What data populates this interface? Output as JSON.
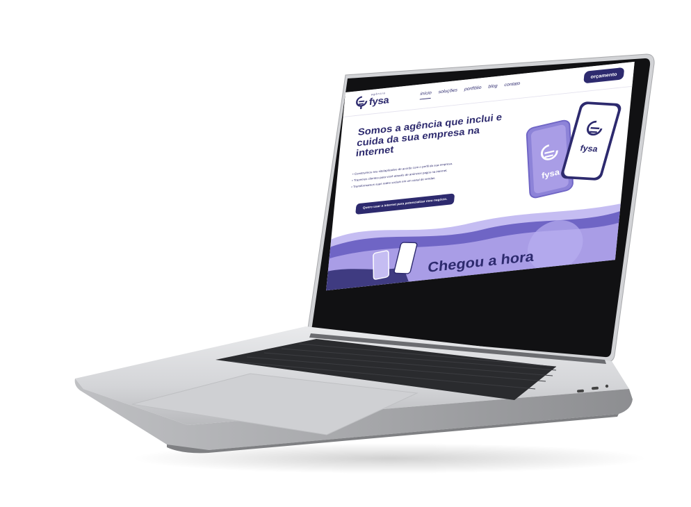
{
  "site": {
    "logo": {
      "brand": "fysa",
      "tagline": "agência",
      "icon": "fysa-logo-icon"
    },
    "nav": {
      "items": [
        {
          "label": "início",
          "active": true
        },
        {
          "label": "soluções"
        },
        {
          "label": "portfólio"
        },
        {
          "label": "blog"
        },
        {
          "label": "contato"
        }
      ],
      "cta_label": "orçamento"
    },
    "hero": {
      "title": "Somos a agência que inclui e cuida da sua empresa na internet",
      "bullets": [
        "Construímos seu site/aplicativo de acordo com o perfil da sua empresa.",
        "Trazemos clientes para você através de anúncios pagos na internet.",
        "Transformamos suas redes sociais em um canal de vendas."
      ],
      "button_label": "Quero usar a internet para potencializar meu negócio."
    },
    "section2": {
      "title_partial": "Chegou a hora"
    },
    "phone_brand": "fysa"
  },
  "colors": {
    "brand_dark": "#2d2a6e",
    "lavender": "#a99de6",
    "lavender_light": "#c5bdf2",
    "purple_mid": "#6f65c5",
    "laptop_silver": "#d9dadc",
    "bezel": "#121214"
  }
}
